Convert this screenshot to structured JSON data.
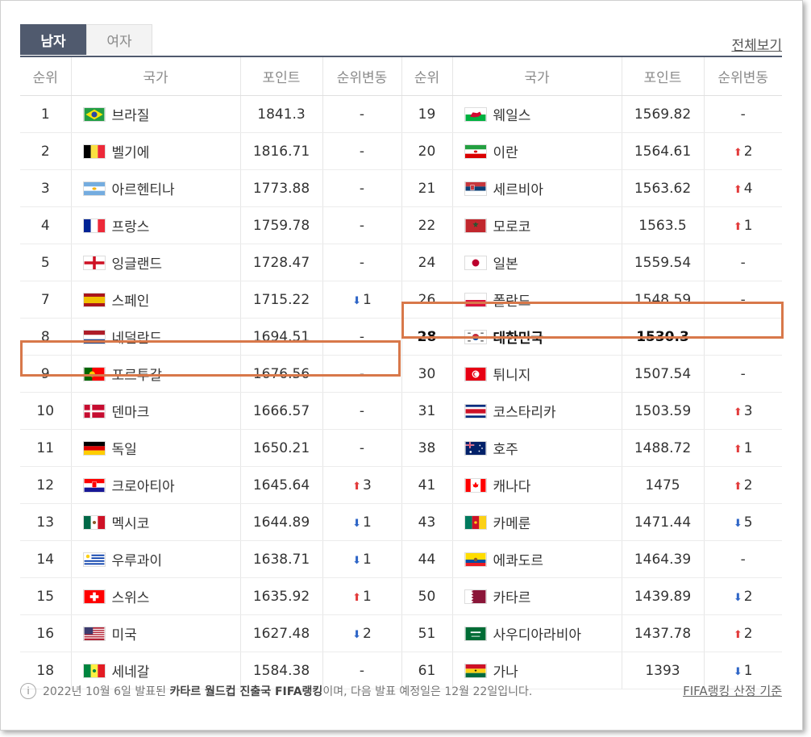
{
  "tabs": {
    "men": "남자",
    "women": "여자"
  },
  "view_all": "전체보기",
  "headers": {
    "rank": "순위",
    "country": "국가",
    "points": "포인트",
    "change": "순위변동"
  },
  "rows": [
    {
      "l_rank": "1",
      "l_flag": "brazil",
      "l_country": "브라질",
      "l_points": "1841.3",
      "l_change": "-",
      "l_dir": "",
      "r_rank": "19",
      "r_flag": "wales",
      "r_country": "웨일스",
      "r_points": "1569.82",
      "r_change": "-",
      "r_dir": ""
    },
    {
      "l_rank": "2",
      "l_flag": "belgium",
      "l_country": "벨기에",
      "l_points": "1816.71",
      "l_change": "-",
      "l_dir": "",
      "r_rank": "20",
      "r_flag": "iran",
      "r_country": "이란",
      "r_points": "1564.61",
      "r_change": "2",
      "r_dir": "up"
    },
    {
      "l_rank": "3",
      "l_flag": "argentina",
      "l_country": "아르헨티나",
      "l_points": "1773.88",
      "l_change": "-",
      "l_dir": "",
      "r_rank": "21",
      "r_flag": "serbia",
      "r_country": "세르비아",
      "r_points": "1563.62",
      "r_change": "4",
      "r_dir": "up"
    },
    {
      "l_rank": "4",
      "l_flag": "france",
      "l_country": "프랑스",
      "l_points": "1759.78",
      "l_change": "-",
      "l_dir": "",
      "r_rank": "22",
      "r_flag": "morocco",
      "r_country": "모로코",
      "r_points": "1563.5",
      "r_change": "1",
      "r_dir": "up"
    },
    {
      "l_rank": "5",
      "l_flag": "england",
      "l_country": "잉글랜드",
      "l_points": "1728.47",
      "l_change": "-",
      "l_dir": "",
      "r_rank": "24",
      "r_flag": "japan",
      "r_country": "일본",
      "r_points": "1559.54",
      "r_change": "-",
      "r_dir": ""
    },
    {
      "l_rank": "7",
      "l_flag": "spain",
      "l_country": "스페인",
      "l_points": "1715.22",
      "l_change": "1",
      "l_dir": "down",
      "r_rank": "26",
      "r_flag": "poland",
      "r_country": "폴란드",
      "r_points": "1548.59",
      "r_change": "-",
      "r_dir": ""
    },
    {
      "l_rank": "8",
      "l_flag": "netherlands",
      "l_country": "네덜란드",
      "l_points": "1694.51",
      "l_change": "-",
      "l_dir": "",
      "r_rank": "28",
      "r_flag": "korea",
      "r_country": "대한민국",
      "r_points": "1530.3",
      "r_change": "-",
      "r_dir": "",
      "r_bold": true
    },
    {
      "l_rank": "9",
      "l_flag": "portugal",
      "l_country": "포르투갈",
      "l_points": "1676.56",
      "l_change": "-",
      "l_dir": "",
      "r_rank": "30",
      "r_flag": "tunisia",
      "r_country": "튀니지",
      "r_points": "1507.54",
      "r_change": "-",
      "r_dir": ""
    },
    {
      "l_rank": "10",
      "l_flag": "denmark",
      "l_country": "덴마크",
      "l_points": "1666.57",
      "l_change": "-",
      "l_dir": "",
      "r_rank": "31",
      "r_flag": "costarica",
      "r_country": "코스타리카",
      "r_points": "1503.59",
      "r_change": "3",
      "r_dir": "up"
    },
    {
      "l_rank": "11",
      "l_flag": "germany",
      "l_country": "독일",
      "l_points": "1650.21",
      "l_change": "-",
      "l_dir": "",
      "r_rank": "38",
      "r_flag": "australia",
      "r_country": "호주",
      "r_points": "1488.72",
      "r_change": "1",
      "r_dir": "up"
    },
    {
      "l_rank": "12",
      "l_flag": "croatia",
      "l_country": "크로아티아",
      "l_points": "1645.64",
      "l_change": "3",
      "l_dir": "up",
      "r_rank": "41",
      "r_flag": "canada",
      "r_country": "캐나다",
      "r_points": "1475",
      "r_change": "2",
      "r_dir": "up"
    },
    {
      "l_rank": "13",
      "l_flag": "mexico",
      "l_country": "멕시코",
      "l_points": "1644.89",
      "l_change": "1",
      "l_dir": "down",
      "r_rank": "43",
      "r_flag": "cameroon",
      "r_country": "카메룬",
      "r_points": "1471.44",
      "r_change": "5",
      "r_dir": "down"
    },
    {
      "l_rank": "14",
      "l_flag": "uruguay",
      "l_country": "우루과이",
      "l_points": "1638.71",
      "l_change": "1",
      "l_dir": "down",
      "r_rank": "44",
      "r_flag": "ecuador",
      "r_country": "에콰도르",
      "r_points": "1464.39",
      "r_change": "-",
      "r_dir": ""
    },
    {
      "l_rank": "15",
      "l_flag": "switzerland",
      "l_country": "스위스",
      "l_points": "1635.92",
      "l_change": "1",
      "l_dir": "up",
      "r_rank": "50",
      "r_flag": "qatar",
      "r_country": "카타르",
      "r_points": "1439.89",
      "r_change": "2",
      "r_dir": "down"
    },
    {
      "l_rank": "16",
      "l_flag": "usa",
      "l_country": "미국",
      "l_points": "1627.48",
      "l_change": "2",
      "l_dir": "down",
      "r_rank": "51",
      "r_flag": "saudi",
      "r_country": "사우디아라비아",
      "r_points": "1437.78",
      "r_change": "2",
      "r_dir": "up"
    },
    {
      "l_rank": "18",
      "l_flag": "senegal",
      "l_country": "세네갈",
      "l_points": "1584.38",
      "l_change": "-",
      "l_dir": "",
      "r_rank": "61",
      "r_flag": "ghana",
      "r_country": "가나",
      "r_points": "1393",
      "r_change": "1",
      "r_dir": "down"
    }
  ],
  "footer": {
    "pre": "2022년 10월 6일 발표된 ",
    "strong": "카타르 월드컵 진출국 FIFA랭킹",
    "post": "이며, 다음 발표 예정일은 12월 22일입니다.",
    "criteria": "FIFA랭킹 산정 기준"
  }
}
